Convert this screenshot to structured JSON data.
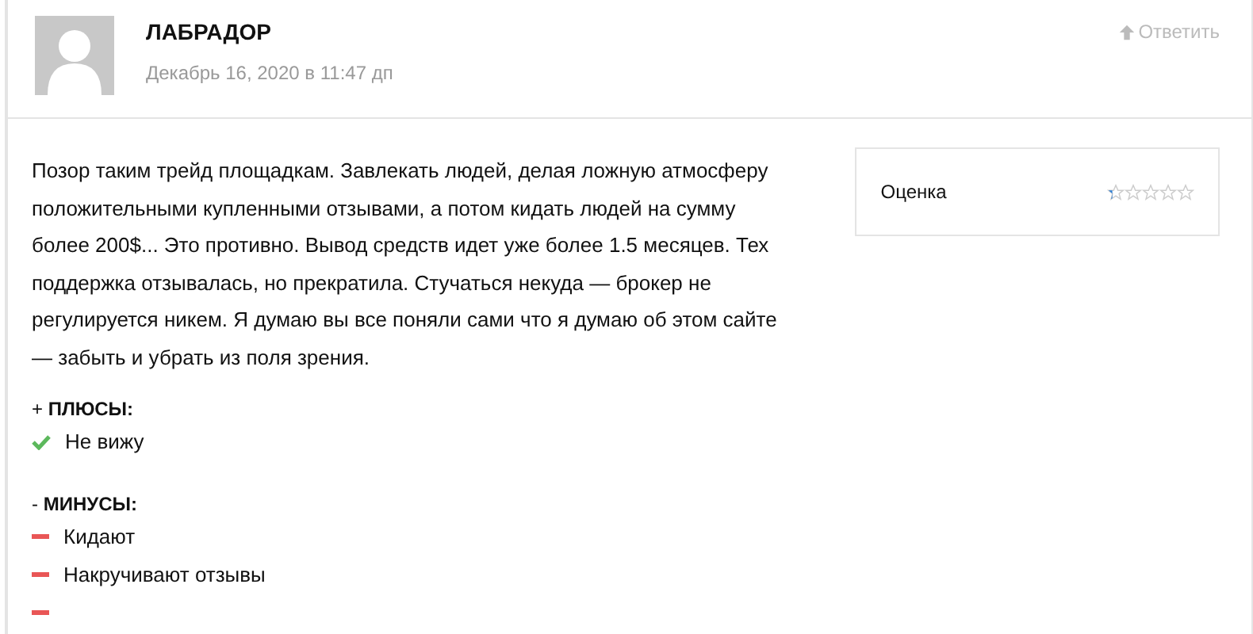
{
  "comment": {
    "author": "ЛАБРАДОР",
    "date": "Декабрь 16, 2020 в 11:47 дп",
    "reply": "Ответить"
  },
  "body": "Позор таким трейд площадкам. Завлекать людей, делая ложную атмосферу положительными купленными отзывами, а потом кидать людей на сумму более 200$... Это противно. Вывод средств идет уже более 1.5 месяцев. Тех поддержка отзывалась, но прекратила. Стучаться некуда — брокер не регулируется никем. Я думаю вы все поняли сами что я думаю об этом сайте — забыть и убрать из поля зрения.",
  "rating": {
    "label": "Оценка",
    "stars": 0.3
  },
  "pros": {
    "heading": "+ **ПЛЮСЫ:**",
    "items": [
      {
        "text": "Не вижу"
      }
    ]
  },
  "cons": {
    "heading": "- **МИНУСЫ:**",
    "items": [
      {
        "kind": "text",
        "text": "Кидают"
      },
      {
        "kind": "text",
        "text": "Накручивают отзывы"
      },
      {
        "kind": "blank"
      }
    ]
  }
}
